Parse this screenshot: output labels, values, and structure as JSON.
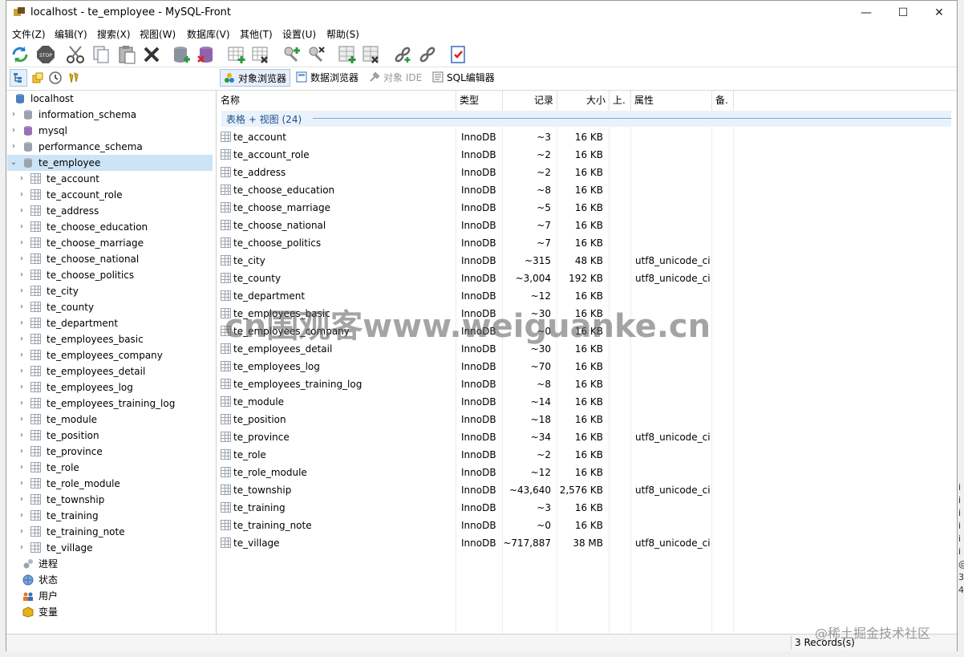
{
  "window": {
    "title": "localhost - te_employee - MySQL-Front",
    "minimize": "—",
    "maximize": "☐",
    "close": "✕"
  },
  "menu": [
    "文件(Z)",
    "编辑(Y)",
    "搜索(X)",
    "视图(W)",
    "数据库(V)",
    "其他(T)",
    "设置(U)",
    "帮助(S)"
  ],
  "toolbar_icons": [
    "refresh-icon",
    "stop-icon",
    "cut-icon",
    "copy-icon",
    "paste-icon",
    "delete-icon",
    "new-database-icon",
    "drop-database-icon",
    "new-table-icon",
    "drop-table-icon",
    "new-user-icon",
    "drop-user-icon",
    "new-field-icon",
    "drop-field-icon",
    "link-icon",
    "unlink-icon",
    "checklist-icon"
  ],
  "view_tabs": [
    {
      "label": "对象浏览器",
      "active": true,
      "icon": "object-browser-icon"
    },
    {
      "label": "数据浏览器",
      "active": false,
      "icon": "data-browser-icon"
    },
    {
      "label": "对象 IDE",
      "active": false,
      "disabled": true,
      "icon": "ide-icon"
    },
    {
      "label": "SQL编辑器",
      "active": false,
      "icon": "sql-editor-icon"
    }
  ],
  "tree": {
    "root": "localhost",
    "databases": [
      "information_schema",
      "mysql",
      "performance_schema"
    ],
    "selected_db": "te_employee",
    "tables": [
      "te_account",
      "te_account_role",
      "te_address",
      "te_choose_education",
      "te_choose_marriage",
      "te_choose_national",
      "te_choose_politics",
      "te_city",
      "te_county",
      "te_department",
      "te_employees_basic",
      "te_employees_company",
      "te_employees_detail",
      "te_employees_log",
      "te_employees_training_log",
      "te_module",
      "te_position",
      "te_province",
      "te_role",
      "te_role_module",
      "te_township",
      "te_training",
      "te_training_note",
      "te_village"
    ],
    "extras": [
      "进程",
      "状态",
      "用户",
      "变量"
    ]
  },
  "columns": {
    "name": "名称",
    "type": "类型",
    "records": "记录",
    "size": "大小",
    "updated": "上.",
    "attributes": "属性",
    "comment": "备."
  },
  "group_label": "表格 + 视图 (24)",
  "rows": [
    {
      "name": "te_account",
      "type": "InnoDB",
      "records": "~3",
      "size": "16 KB",
      "attr": ""
    },
    {
      "name": "te_account_role",
      "type": "InnoDB",
      "records": "~2",
      "size": "16 KB",
      "attr": ""
    },
    {
      "name": "te_address",
      "type": "InnoDB",
      "records": "~2",
      "size": "16 KB",
      "attr": ""
    },
    {
      "name": "te_choose_education",
      "type": "InnoDB",
      "records": "~8",
      "size": "16 KB",
      "attr": ""
    },
    {
      "name": "te_choose_marriage",
      "type": "InnoDB",
      "records": "~5",
      "size": "16 KB",
      "attr": ""
    },
    {
      "name": "te_choose_national",
      "type": "InnoDB",
      "records": "~7",
      "size": "16 KB",
      "attr": ""
    },
    {
      "name": "te_choose_politics",
      "type": "InnoDB",
      "records": "~7",
      "size": "16 KB",
      "attr": ""
    },
    {
      "name": "te_city",
      "type": "InnoDB",
      "records": "~315",
      "size": "48 KB",
      "attr": "utf8_unicode_ci"
    },
    {
      "name": "te_county",
      "type": "InnoDB",
      "records": "~3,004",
      "size": "192 KB",
      "attr": "utf8_unicode_ci"
    },
    {
      "name": "te_department",
      "type": "InnoDB",
      "records": "~12",
      "size": "16 KB",
      "attr": ""
    },
    {
      "name": "te_employees_basic",
      "type": "InnoDB",
      "records": "~30",
      "size": "16 KB",
      "attr": ""
    },
    {
      "name": "te_employees_company",
      "type": "InnoDB",
      "records": "~0",
      "size": "16 KB",
      "attr": ""
    },
    {
      "name": "te_employees_detail",
      "type": "InnoDB",
      "records": "~30",
      "size": "16 KB",
      "attr": ""
    },
    {
      "name": "te_employees_log",
      "type": "InnoDB",
      "records": "~70",
      "size": "16 KB",
      "attr": ""
    },
    {
      "name": "te_employees_training_log",
      "type": "InnoDB",
      "records": "~8",
      "size": "16 KB",
      "attr": ""
    },
    {
      "name": "te_module",
      "type": "InnoDB",
      "records": "~14",
      "size": "16 KB",
      "attr": ""
    },
    {
      "name": "te_position",
      "type": "InnoDB",
      "records": "~18",
      "size": "16 KB",
      "attr": ""
    },
    {
      "name": "te_province",
      "type": "InnoDB",
      "records": "~34",
      "size": "16 KB",
      "attr": "utf8_unicode_ci"
    },
    {
      "name": "te_role",
      "type": "InnoDB",
      "records": "~2",
      "size": "16 KB",
      "attr": ""
    },
    {
      "name": "te_role_module",
      "type": "InnoDB",
      "records": "~12",
      "size": "16 KB",
      "attr": ""
    },
    {
      "name": "te_township",
      "type": "InnoDB",
      "records": "~43,640",
      "size": "2,576 KB",
      "attr": "utf8_unicode_ci"
    },
    {
      "name": "te_training",
      "type": "InnoDB",
      "records": "~3",
      "size": "16 KB",
      "attr": ""
    },
    {
      "name": "te_training_note",
      "type": "InnoDB",
      "records": "~0",
      "size": "16 KB",
      "attr": ""
    },
    {
      "name": "te_village",
      "type": "InnoDB",
      "records": "~717,887",
      "size": "38 MB",
      "attr": "utf8_unicode_ci"
    }
  ],
  "status": "3 Records(s)",
  "watermark": "cn围观客www.weiguanke.cn",
  "watermark2": "@稀土掘金技术社区",
  "edge_chars": [
    "i",
    "i",
    "i",
    "i",
    "i",
    "i",
    "@",
    "3",
    "4"
  ]
}
